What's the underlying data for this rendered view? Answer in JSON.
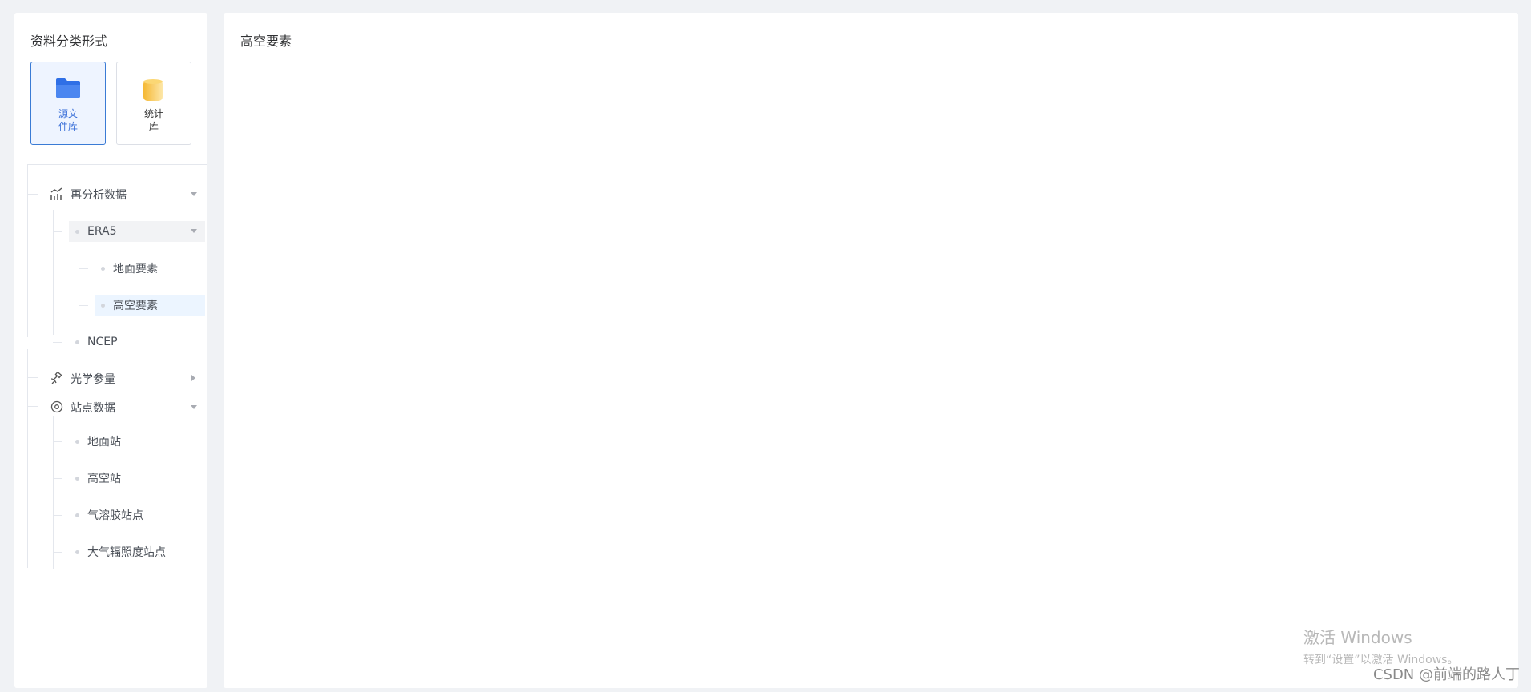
{
  "sidebar": {
    "title": "资料分类形式",
    "cards": [
      {
        "line1": "源文",
        "line2": "件库",
        "icon": "folder-icon",
        "active": true
      },
      {
        "line1": "统计",
        "line2": "库",
        "icon": "database-icon",
        "active": false
      }
    ],
    "tree": {
      "reanalysis": {
        "label": "再分析数据",
        "icon": "chart-icon"
      },
      "era5": {
        "label": "ERA5"
      },
      "surface": {
        "label": "地面要素"
      },
      "upper": {
        "label": "高空要素"
      },
      "ncep": {
        "label": "NCEP"
      },
      "optical": {
        "label": "光学参量",
        "icon": "satellite-icon"
      },
      "station": {
        "label": "站点数据",
        "icon": "location-icon"
      },
      "ground_station": {
        "label": "地面站"
      },
      "upper_station": {
        "label": "高空站"
      },
      "aerosol_station": {
        "label": "气溶胶站点"
      },
      "radiance_station": {
        "label": "大气辐照度站点"
      }
    }
  },
  "main": {
    "title": "高空要素"
  },
  "watermark": {
    "line1": "激活 Windows",
    "line2": "转到“设置”以激活 Windows。"
  },
  "csdn": "CSDN @前端的路人丁",
  "colors": {
    "accent": "#3a7bd5",
    "folder": "#2f6fe6",
    "db": "#f5c452"
  }
}
